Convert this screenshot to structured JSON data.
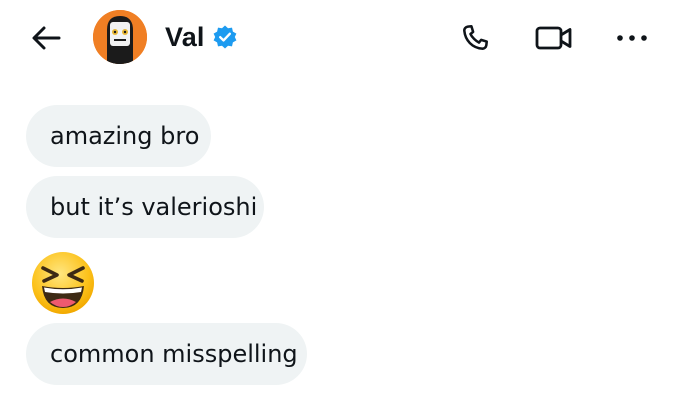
{
  "header": {
    "contact_name": "Val",
    "back_icon": "arrow-left-icon",
    "verified_icon": "verified-badge-icon",
    "call_icon": "phone-icon",
    "video_icon": "video-camera-icon",
    "more_icon": "more-horizontal-icon",
    "colors": {
      "verified": "#1d9bf0",
      "avatar_bg": "#f07f24"
    }
  },
  "messages": [
    {
      "type": "text",
      "text": "amazing bro"
    },
    {
      "type": "text",
      "text": "but it’s valerioshi"
    },
    {
      "type": "emoji",
      "text": "😆"
    },
    {
      "type": "text",
      "text": "common misspelling"
    }
  ],
  "colors": {
    "bubble_bg": "#eff3f4",
    "text": "#0f1419"
  }
}
